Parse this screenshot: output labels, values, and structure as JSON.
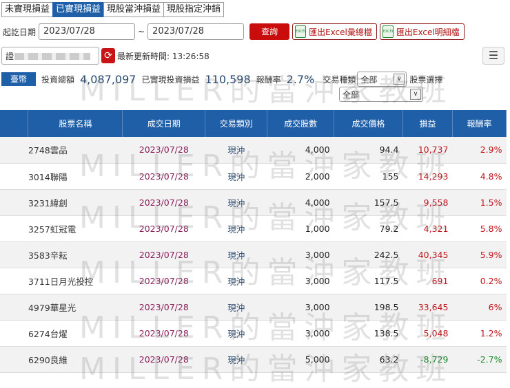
{
  "tabs": [
    "未實現損益",
    "已實現損益",
    "現股當沖損益",
    "現股指定沖銷"
  ],
  "active_tab": 1,
  "query": {
    "label": "起訖日期",
    "start": "2023/07/28",
    "sep": "~",
    "end": "2023/07/28",
    "search": "查詢",
    "export_summary": "匯出Excel彙總檔",
    "export_detail": "匯出Excel明細檔",
    "excel_icon": "EXCEL"
  },
  "account": {
    "prefix": "證",
    "last_update": "最新更新時間: 13:26:58"
  },
  "summary": {
    "currency": "臺幣",
    "invest_label": "投資總額",
    "invest": "4,087,097",
    "pl_label": "已實現投資損益",
    "pl": "110,598",
    "rate_label": "報酬率",
    "rate": "2.7%",
    "trade_type_label": "交易種類",
    "trade_type": "全部",
    "stock_label": "股票選擇",
    "stock": "全部"
  },
  "table": {
    "headers": [
      "",
      "股票名稱",
      "成交日期",
      "交易類別",
      "成交股數",
      "成交價格",
      "損益",
      "報酬率"
    ],
    "rows": [
      {
        "name": "2748雲品",
        "date": "2023/07/28",
        "type": "現沖",
        "qty": "4,000",
        "price": "94.4",
        "pl": "10,737",
        "rate": "2.9%",
        "sign": "pos"
      },
      {
        "name": "3014聯陽",
        "date": "2023/07/28",
        "type": "現沖",
        "qty": "2,000",
        "price": "155",
        "pl": "14,293",
        "rate": "4.8%",
        "sign": "pos"
      },
      {
        "name": "3231緯創",
        "date": "2023/07/28",
        "type": "現沖",
        "qty": "4,000",
        "price": "157.5",
        "pl": "9,558",
        "rate": "1.5%",
        "sign": "pos"
      },
      {
        "name": "3257虹冠電",
        "date": "2023/07/28",
        "type": "現沖",
        "qty": "1,000",
        "price": "79.2",
        "pl": "4,321",
        "rate": "5.8%",
        "sign": "pos"
      },
      {
        "name": "3583辛耘",
        "date": "2023/07/28",
        "type": "現沖",
        "qty": "3,000",
        "price": "242.5",
        "pl": "40,345",
        "rate": "5.9%",
        "sign": "pos"
      },
      {
        "name": "3711日月光投控",
        "date": "2023/07/28",
        "type": "現沖",
        "qty": "3,000",
        "price": "117.5",
        "pl": "691",
        "rate": "0.2%",
        "sign": "pos"
      },
      {
        "name": "4979華星光",
        "date": "2023/07/28",
        "type": "現沖",
        "qty": "3,000",
        "price": "198.5",
        "pl": "33,645",
        "rate": "6%",
        "sign": "pos"
      },
      {
        "name": "6274台燿",
        "date": "2023/07/28",
        "type": "現沖",
        "qty": "3,000",
        "price": "138.5",
        "pl": "5,048",
        "rate": "1.2%",
        "sign": "pos"
      },
      {
        "name": "6290良維",
        "date": "2023/07/28",
        "type": "現沖",
        "qty": "5,000",
        "price": "63.2",
        "pl": "-8,729",
        "rate": "-2.7%",
        "sign": "neg"
      }
    ]
  },
  "watermark": "MILLER的當沖家教班"
}
